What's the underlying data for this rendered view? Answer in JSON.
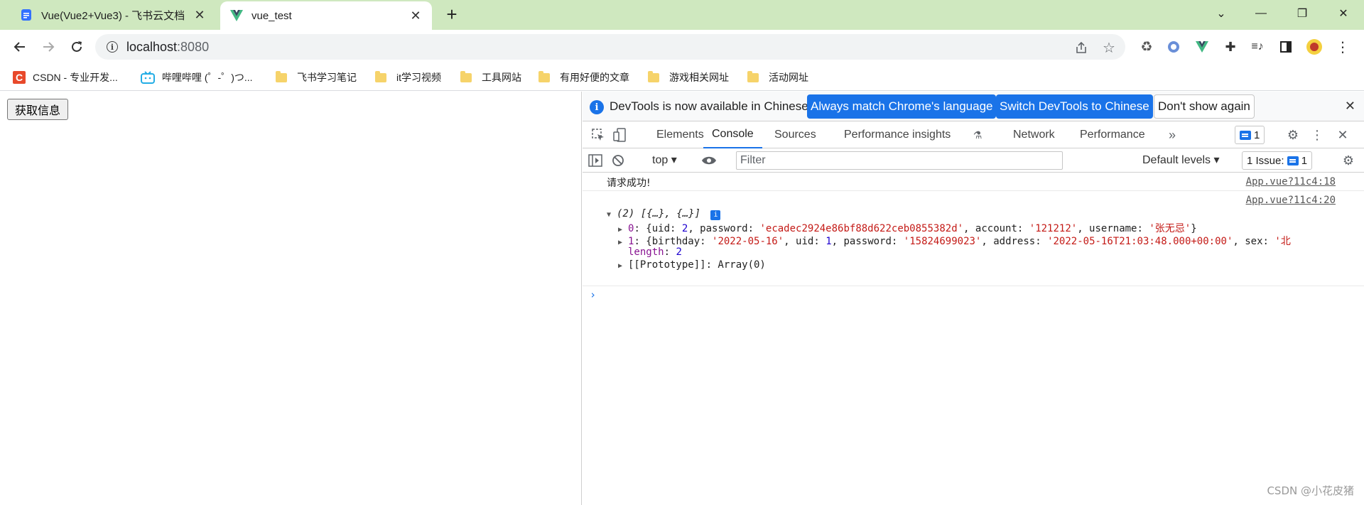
{
  "browser": {
    "tabs": [
      {
        "title": "Vue(Vue2+Vue3) - 飞书云文档",
        "active": false,
        "icon": "doc-icon"
      },
      {
        "title": "vue_test",
        "active": true,
        "icon": "vue-logo-icon"
      }
    ],
    "url_host": "localhost",
    "url_port": ":8080",
    "bookmarks": [
      {
        "label": "CSDN - 专业开发...",
        "icon": "csdn-icon"
      },
      {
        "label": "哔哩哔哩 (゜-゜)つ...",
        "icon": "bilibili-icon"
      },
      {
        "label": "飞书学习笔记",
        "icon": "folder-icon"
      },
      {
        "label": "it学习视频",
        "icon": "folder-icon"
      },
      {
        "label": "工具网站",
        "icon": "folder-icon"
      },
      {
        "label": "有用好便的文章",
        "icon": "folder-icon"
      },
      {
        "label": "游戏相关网址",
        "icon": "folder-icon"
      },
      {
        "label": "活动网址",
        "icon": "folder-icon"
      }
    ]
  },
  "page": {
    "button_label": "获取信息"
  },
  "devtools": {
    "infobar": {
      "message": "DevTools is now available in Chinese!",
      "btn_match": "Always match Chrome's language",
      "btn_switch": "Switch DevTools to Chinese",
      "btn_dismiss": "Don't show again"
    },
    "tabs": [
      "Elements",
      "Console",
      "Sources",
      "Performance insights",
      "Network",
      "Performance"
    ],
    "active_tab": "Console",
    "message_count": "1",
    "console_toolbar": {
      "context": "top",
      "filter_placeholder": "Filter",
      "levels": "Default levels",
      "issues_label": "1 Issue:",
      "issues_count": "1"
    },
    "logs": {
      "log1_text": "请求成功!",
      "log1_source": "App.vue?11c4:18",
      "log2_source": "App.vue?11c4:20",
      "array_summary": "(2) [{…}, {…}]",
      "item0_index": "0",
      "item0_uid": "2",
      "item0_password": "'ecadec2924e86bf88d622ceb0855382d'",
      "item0_account": "'121212'",
      "item0_username": "'张无忌'",
      "item1_index": "1",
      "item1_birthday": "'2022-05-16'",
      "item1_uid": "1",
      "item1_password": "'15824699023'",
      "item1_address": "'2022-05-16T21:03:48.000+00:00'",
      "item1_sex": "'北",
      "length_key": "length",
      "length_value": "2",
      "prototype": "[[Prototype]]: Array(0)"
    }
  },
  "watermark": "CSDN @小花皮猪",
  "colors": {
    "tabstrip": "#cfe8bf",
    "accent": "#1a73e8",
    "string": "#c41a16",
    "number": "#1c00cf",
    "property": "#881391"
  }
}
